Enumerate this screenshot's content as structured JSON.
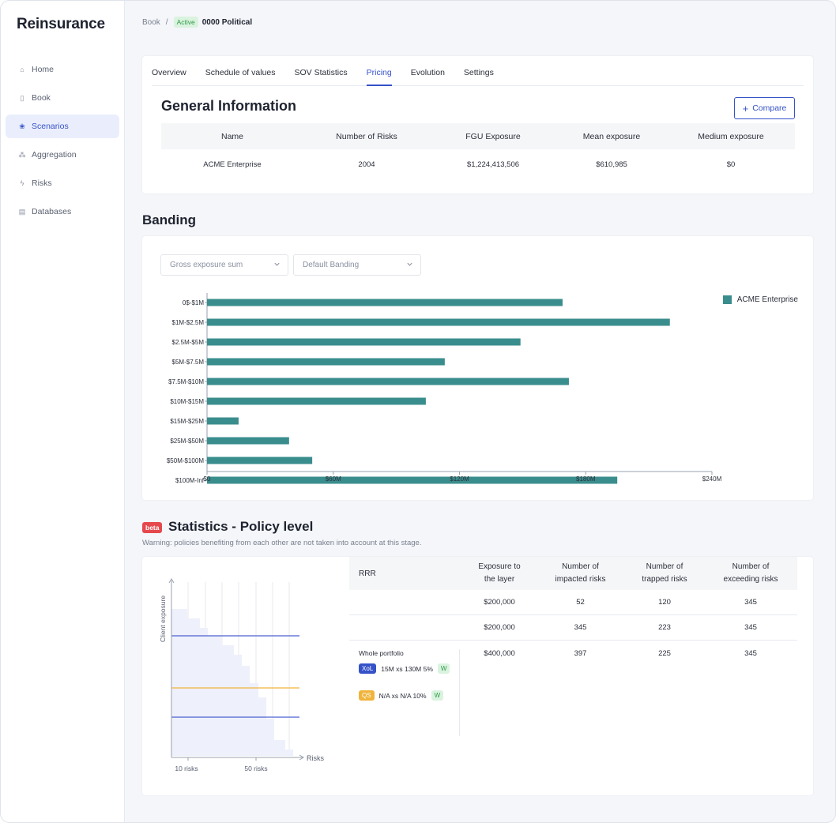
{
  "app": {
    "title": "Reinsurance"
  },
  "sidebar": {
    "items": [
      {
        "label": "Home",
        "icon": "home-icon",
        "glyph": "⌂",
        "active": false
      },
      {
        "label": "Book",
        "icon": "book-icon",
        "glyph": "▯",
        "active": false
      },
      {
        "label": "Scenarios",
        "icon": "scenarios-icon",
        "glyph": "❀",
        "active": true
      },
      {
        "label": "Aggregation",
        "icon": "aggregation-icon",
        "glyph": "⁂",
        "active": false
      },
      {
        "label": "Risks",
        "icon": "risks-icon",
        "glyph": "ϟ",
        "active": false
      },
      {
        "label": "Databases",
        "icon": "databases-icon",
        "glyph": "▤",
        "active": false
      }
    ]
  },
  "breadcrumb": {
    "root": "Book",
    "separator": "/",
    "status": "Active",
    "current": "0000 Political"
  },
  "tabs": [
    {
      "label": "Overview",
      "active": false
    },
    {
      "label": "Schedule of values",
      "active": false
    },
    {
      "label": "SOV Statistics",
      "active": false
    },
    {
      "label": "Pricing",
      "active": true
    },
    {
      "label": "Evolution",
      "active": false
    },
    {
      "label": "Settings",
      "active": false
    }
  ],
  "general": {
    "title": "General Information",
    "compare_label": "Compare",
    "columns": [
      "Name",
      "Number of Risks",
      "FGU Exposure",
      "Mean exposure",
      "Medium exposure"
    ],
    "row": [
      "ACME Enterprise",
      "2004",
      "$1,224,413,506",
      "$610,985",
      "$0"
    ]
  },
  "banding": {
    "title": "Banding",
    "dropdown1": "Gross exposure sum",
    "dropdown2": "Default Banding"
  },
  "chart_data": {
    "type": "bar",
    "orientation": "horizontal",
    "categories": [
      "0$-$1M",
      "$1M-$2.5M",
      "$2.5M-$5M",
      "$5M-$7.5M",
      "$7.5M-$10M",
      "$10M-$15M",
      "$15M-$25M",
      "$25M-$50M",
      "$50M-$100M",
      "$100M-Inf"
    ],
    "series": [
      {
        "name": "ACME Enterprise",
        "values": [
          169,
          220,
          149,
          113,
          172,
          104,
          15,
          39,
          50,
          195
        ]
      }
    ],
    "xlim": [
      0,
      240
    ],
    "x_ticks": [
      "$0",
      "$60M",
      "$120M",
      "$180M",
      "$240M"
    ],
    "x_tick_values": [
      0,
      60,
      120,
      180,
      240
    ],
    "unit": "$M",
    "color": "#3a8d8d",
    "legend": "top-right"
  },
  "stats": {
    "beta": "beta",
    "title": "Statistics - Policy level",
    "warning": "Warning: policies benefiting from each other are not taken into account at this stage.",
    "columns": [
      "RRR",
      "Exposure to the layer",
      "Number of impacted risks",
      "Number of trapped risks",
      "Number of exceeding risks"
    ],
    "rows": [
      [
        "",
        "$200,000",
        "52",
        "120",
        "345"
      ],
      [
        "",
        "$200,000",
        "345",
        "223",
        "345"
      ],
      [
        "Whole portfolio",
        "$400,000",
        "397",
        "225",
        "345"
      ]
    ],
    "layers": [
      {
        "tag": "XoL",
        "text": "15M xs 130M 5%",
        "w": "W"
      },
      {
        "tag": "QS",
        "text": "N/A xs N/A 10%",
        "w": "W"
      }
    ],
    "mini_chart": {
      "y_label": "Client exposure",
      "x_label": "Risks",
      "x_ticks": [
        "10 risks",
        "50 risks"
      ]
    }
  }
}
